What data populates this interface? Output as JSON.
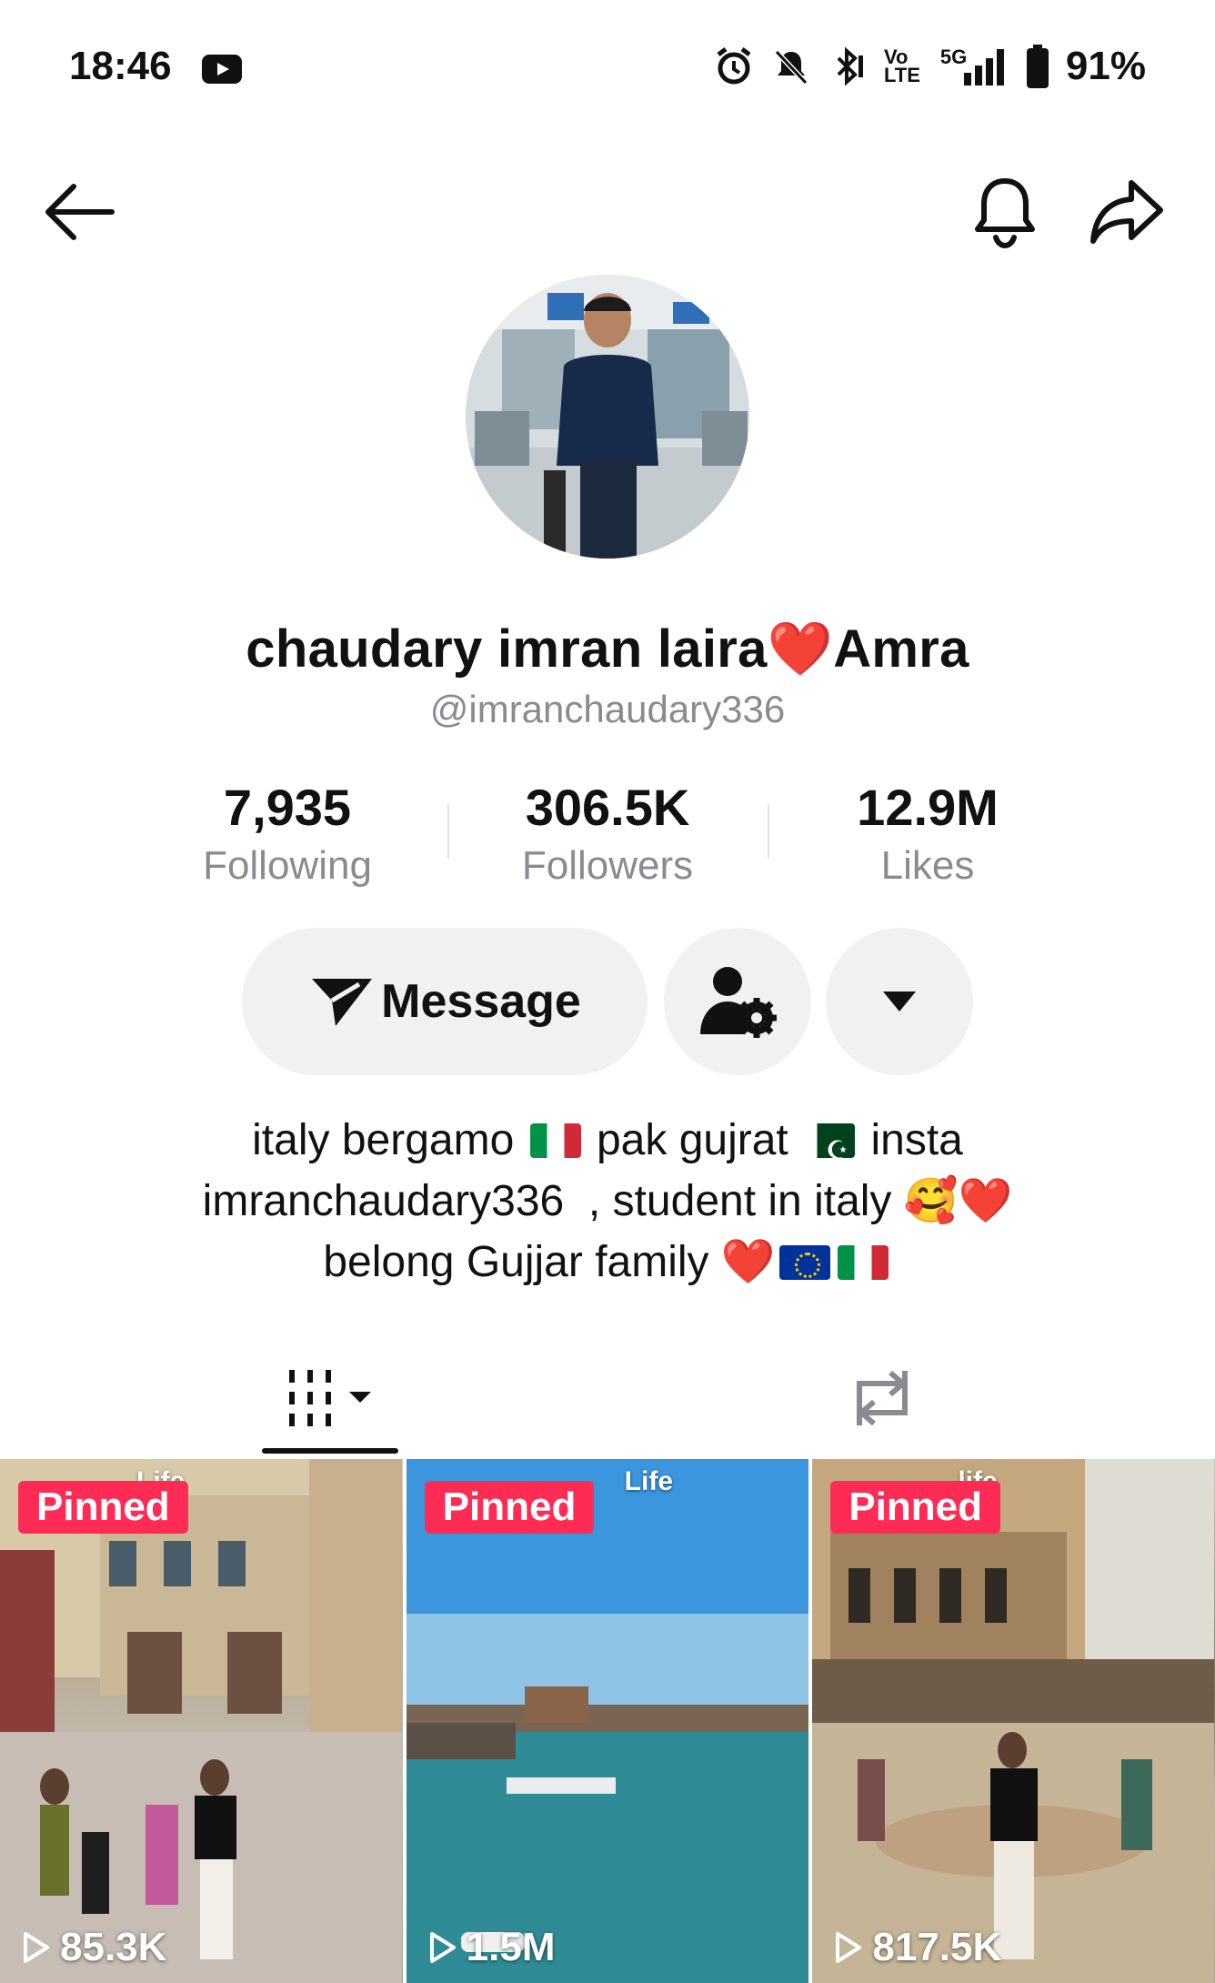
{
  "status_bar": {
    "time": "18:46",
    "net_vo": "Vo",
    "net_lte": "LTE",
    "net_5g": "5G",
    "battery": "91%"
  },
  "profile": {
    "display_name_part1": "chaudary imran laira",
    "display_name_heart": "❤️",
    "display_name_part2": "Amra",
    "username": "@imranchaudary336"
  },
  "stats": [
    {
      "value": "7,935",
      "label": "Following"
    },
    {
      "value": "306.5K",
      "label": "Followers"
    },
    {
      "value": "12.9M",
      "label": "Likes"
    }
  ],
  "actions": {
    "message_label": "Message"
  },
  "bio": {
    "line1_a": "italy bergamo",
    "line1_b": "pak gujrat",
    "line1_c": "insta",
    "line2_a": "imranchaudary336  , student in italy",
    "line2_emoji": "🥰❤️",
    "line3_a": "belong Gujjar family",
    "line3_heart": "❤️"
  },
  "videos": [
    {
      "pinned_label": "Pinned",
      "views": "85.3K",
      "overlay_text": "Life"
    },
    {
      "pinned_label": "Pinned",
      "views": "1.5M",
      "overlay_text": "Life"
    },
    {
      "pinned_label": "Pinned",
      "views": "817.5K",
      "overlay_text": "life"
    }
  ],
  "colors": {
    "accent_pinned": "#fe2c55",
    "heart": "#e0282e",
    "secondary_text": "#8a8b91",
    "button_bg": "#f1f1f2"
  }
}
